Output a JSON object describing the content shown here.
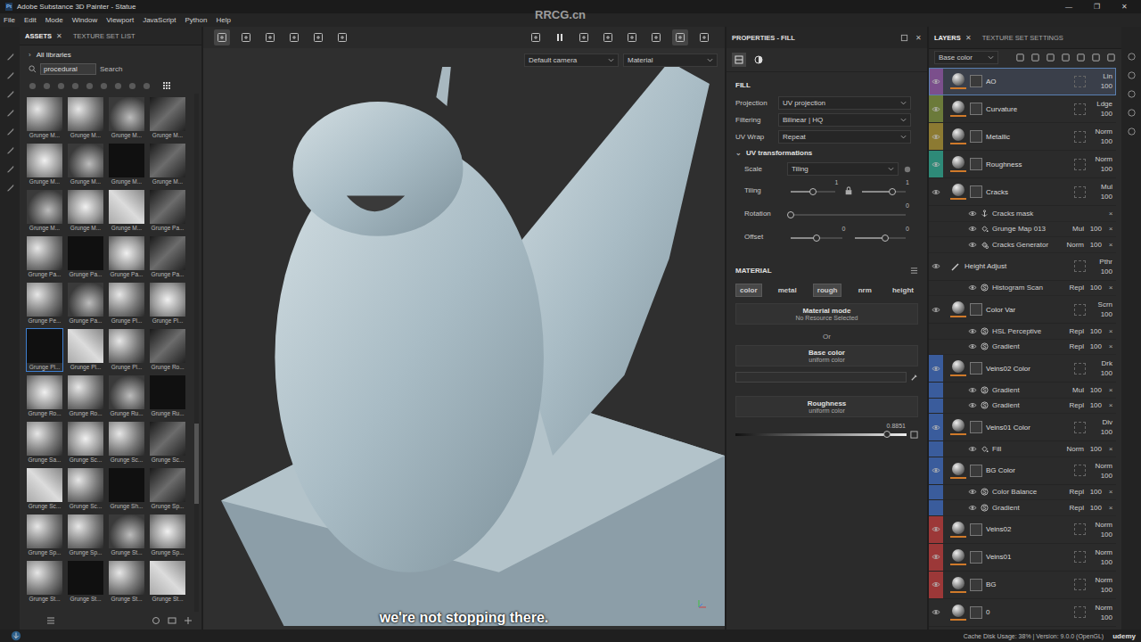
{
  "window": {
    "title": "Adobe Substance 3D Painter - Statue",
    "app_icon": "Pt",
    "controls": [
      "—",
      "❐",
      "✕"
    ]
  },
  "watermark": "RRCG.cn",
  "menu": [
    "File",
    "Edit",
    "Mode",
    "Window",
    "Viewport",
    "JavaScript",
    "Python",
    "Help"
  ],
  "assets": {
    "tabs": [
      {
        "label": "ASSETS",
        "selected": true,
        "close": "✕"
      },
      {
        "label": "TEXTURE SET LIST",
        "selected": false,
        "close": ""
      }
    ],
    "library": {
      "expander": "›",
      "label": "All libraries"
    },
    "search": {
      "value": "procedural",
      "button": "Search"
    },
    "thumbnails": [
      {
        "label": "Grunge M...",
        "selected": false
      },
      {
        "label": "Grunge M...",
        "selected": false
      },
      {
        "label": "Grunge M...",
        "selected": false
      },
      {
        "label": "Grunge M...",
        "selected": false
      },
      {
        "label": "Grunge M...",
        "selected": false
      },
      {
        "label": "Grunge M...",
        "selected": false
      },
      {
        "label": "Grunge M...",
        "selected": false
      },
      {
        "label": "Grunge M...",
        "selected": false
      },
      {
        "label": "Grunge M...",
        "selected": false
      },
      {
        "label": "Grunge M...",
        "selected": false
      },
      {
        "label": "Grunge M...",
        "selected": false
      },
      {
        "label": "Grunge Pa...",
        "selected": false
      },
      {
        "label": "Grunge Pa...",
        "selected": false
      },
      {
        "label": "Grunge Pa...",
        "selected": false
      },
      {
        "label": "Grunge Pa...",
        "selected": false
      },
      {
        "label": "Grunge Pa...",
        "selected": false
      },
      {
        "label": "Grunge Pe...",
        "selected": false
      },
      {
        "label": "Grunge Pa...",
        "selected": false
      },
      {
        "label": "Grunge Pl...",
        "selected": false
      },
      {
        "label": "Grunge Pl...",
        "selected": false
      },
      {
        "label": "Grunge Pl...",
        "selected": true
      },
      {
        "label": "Grunge Pl...",
        "selected": false
      },
      {
        "label": "Grunge Pl...",
        "selected": false
      },
      {
        "label": "Grunge Ro...",
        "selected": false
      },
      {
        "label": "Grunge Ro...",
        "selected": false
      },
      {
        "label": "Grunge Ro...",
        "selected": false
      },
      {
        "label": "Grunge Ru...",
        "selected": false
      },
      {
        "label": "Grunge Ru...",
        "selected": false
      },
      {
        "label": "Grunge Sa...",
        "selected": false
      },
      {
        "label": "Grunge Sc...",
        "selected": false
      },
      {
        "label": "Grunge Sc...",
        "selected": false
      },
      {
        "label": "Grunge Sc...",
        "selected": false
      },
      {
        "label": "Grunge Sc...",
        "selected": false
      },
      {
        "label": "Grunge Sc...",
        "selected": false
      },
      {
        "label": "Grunge Sh...",
        "selected": false
      },
      {
        "label": "Grunge Sp...",
        "selected": false
      },
      {
        "label": "Grunge Sp...",
        "selected": false
      },
      {
        "label": "Grunge Sp...",
        "selected": false
      },
      {
        "label": "Grunge St...",
        "selected": false
      },
      {
        "label": "Grunge Sp...",
        "selected": false
      },
      {
        "label": "Grunge St...",
        "selected": false
      },
      {
        "label": "Grunge St...",
        "selected": false
      },
      {
        "label": "Grunge St...",
        "selected": false
      },
      {
        "label": "Grunge St...",
        "selected": false
      }
    ]
  },
  "viewport": {
    "camera": "Default camera",
    "mode": "Material",
    "subtitle": "we're not stopping there."
  },
  "properties": {
    "title": "PROPERTIES - FILL",
    "close": "✕",
    "section": "FILL",
    "fields": [
      {
        "label": "Projection",
        "value": "UV projection"
      },
      {
        "label": "Filtering",
        "value": "Bilinear | HQ"
      },
      {
        "label": "UV Wrap",
        "value": "Repeat"
      }
    ],
    "uv": {
      "label": "UV transformations",
      "expanded": true,
      "expander": "⌄",
      "scale": {
        "label": "Scale",
        "value": "Tiling"
      },
      "sliders": [
        {
          "label": "Tiling",
          "locked": true,
          "values": [
            {
              "reading": "1",
              "level": 0.5
            },
            {
              "reading": "1",
              "level": 0.7
            }
          ]
        },
        {
          "label": "Rotation",
          "locked": false,
          "values": [
            {
              "reading": "0",
              "level": 0
            }
          ]
        },
        {
          "label": "Offset",
          "locked": false,
          "values": [
            {
              "reading": "0",
              "level": 0.5
            },
            {
              "reading": "0",
              "level": 0.6
            }
          ]
        }
      ]
    },
    "material": {
      "title": "MATERIAL",
      "channels": [
        {
          "label": "color",
          "selected": true
        },
        {
          "label": "metal",
          "selected": false
        },
        {
          "label": "rough",
          "selected": true
        },
        {
          "label": "nrm",
          "selected": false
        },
        {
          "label": "height",
          "selected": false
        }
      ],
      "mode": {
        "title": "Material mode",
        "sub": "No Resource Selected"
      },
      "or": "Or",
      "base": {
        "title": "Base color",
        "sub": "uniform color",
        "color": "#2f2f2f"
      },
      "roughness": {
        "title": "Roughness",
        "sub": "uniform color",
        "reading": "0.8851",
        "level": 0.8851
      }
    }
  },
  "layers": {
    "tabs": [
      {
        "label": "LAYERS",
        "selected": true,
        "close": "✕"
      },
      {
        "label": "TEXTURE SET SETTINGS",
        "selected": false,
        "close": ""
      }
    ],
    "channel": "Base color",
    "remove": "×",
    "items": [
      {
        "kind": "fill-layer",
        "name": "AO",
        "blend": "Lin",
        "opacity": "100",
        "color": "#7b4f8c",
        "selected": true,
        "visible": true,
        "children": []
      },
      {
        "kind": "fill-layer",
        "name": "Curvature",
        "blend": "Ldge",
        "opacity": "100",
        "color": "#6b7a3a",
        "selected": false,
        "visible": true,
        "children": []
      },
      {
        "kind": "fill-layer",
        "name": "Metallic",
        "blend": "Norm",
        "opacity": "100",
        "color": "#8c7a32",
        "selected": false,
        "visible": true,
        "children": []
      },
      {
        "kind": "fill-layer",
        "name": "Roughness",
        "blend": "Norm",
        "opacity": "100",
        "color": "#2e8a78",
        "selected": false,
        "visible": true,
        "children": []
      },
      {
        "kind": "fill-layer",
        "name": "Cracks",
        "blend": "Mul",
        "opacity": "100",
        "color": "#2b2b2b",
        "selected": false,
        "visible": true,
        "children": [
          {
            "kind": "anchor",
            "name": "Cracks mask",
            "blend": "",
            "opacity": "",
            "visible": true
          },
          {
            "kind": "fill",
            "name": "Grunge Map 013",
            "blend": "Mul",
            "opacity": "100",
            "visible": true
          },
          {
            "kind": "generator",
            "name": "Cracks Generator",
            "blend": "Norm",
            "opacity": "100",
            "visible": true
          }
        ]
      },
      {
        "kind": "paint-layer",
        "name": "Height Adjust",
        "blend": "Pthr",
        "opacity": "100",
        "color": "#2b2b2b",
        "selected": false,
        "visible": true,
        "children": [
          {
            "kind": "filter",
            "name": "Histogram Scan",
            "blend": "Repl",
            "opacity": "100",
            "visible": true
          }
        ]
      },
      {
        "kind": "fill-layer",
        "name": "Color Var",
        "blend": "Scrn",
        "opacity": "100",
        "color": "#2b2b2b",
        "selected": false,
        "visible": true,
        "children": [
          {
            "kind": "filter",
            "name": "HSL Perceptive",
            "blend": "Repl",
            "opacity": "100",
            "visible": true
          },
          {
            "kind": "filter",
            "name": "Gradient",
            "blend": "Repl",
            "opacity": "100",
            "visible": true
          }
        ]
      },
      {
        "kind": "fill-layer",
        "name": "Veins02 Color",
        "blend": "Drk",
        "opacity": "100",
        "color": "#3a5c9c",
        "selected": false,
        "visible": true,
        "children": [
          {
            "kind": "filter",
            "name": "Gradient",
            "blend": "Mul",
            "opacity": "100",
            "visible": true
          },
          {
            "kind": "filter",
            "name": "Gradient",
            "blend": "Repl",
            "opacity": "100",
            "visible": true
          }
        ]
      },
      {
        "kind": "fill-layer",
        "name": "Veins01 Color",
        "blend": "Div",
        "opacity": "100",
        "color": "#3a5c9c",
        "selected": false,
        "visible": true,
        "children": [
          {
            "kind": "fill",
            "name": "Fill",
            "blend": "Norm",
            "opacity": "100",
            "visible": true
          }
        ]
      },
      {
        "kind": "fill-layer",
        "name": "BG Color",
        "blend": "Norm",
        "opacity": "100",
        "color": "#3a5c9c",
        "selected": false,
        "visible": true,
        "children": [
          {
            "kind": "filter",
            "name": "Color Balance",
            "blend": "Repl",
            "opacity": "100",
            "visible": true
          },
          {
            "kind": "filter",
            "name": "Gradient",
            "blend": "Repl",
            "opacity": "100",
            "visible": true
          }
        ]
      },
      {
        "kind": "fill-layer",
        "name": "Veins02",
        "blend": "Norm",
        "opacity": "100",
        "color": "#9c3838",
        "selected": false,
        "visible": true,
        "children": []
      },
      {
        "kind": "fill-layer",
        "name": "Veins01",
        "blend": "Norm",
        "opacity": "100",
        "color": "#9c3838",
        "selected": false,
        "visible": true,
        "children": []
      },
      {
        "kind": "fill-layer",
        "name": "BG",
        "blend": "Norm",
        "opacity": "100",
        "color": "#9c3838",
        "selected": false,
        "visible": true,
        "children": []
      },
      {
        "kind": "fill-layer",
        "name": "0",
        "blend": "Norm",
        "opacity": "100",
        "color": "#2b2b2b",
        "selected": false,
        "visible": true,
        "children": []
      }
    ]
  },
  "status": "Cache Disk Usage:  38% | Version: 9.0.0 (OpenGL)",
  "badge": "udemy"
}
